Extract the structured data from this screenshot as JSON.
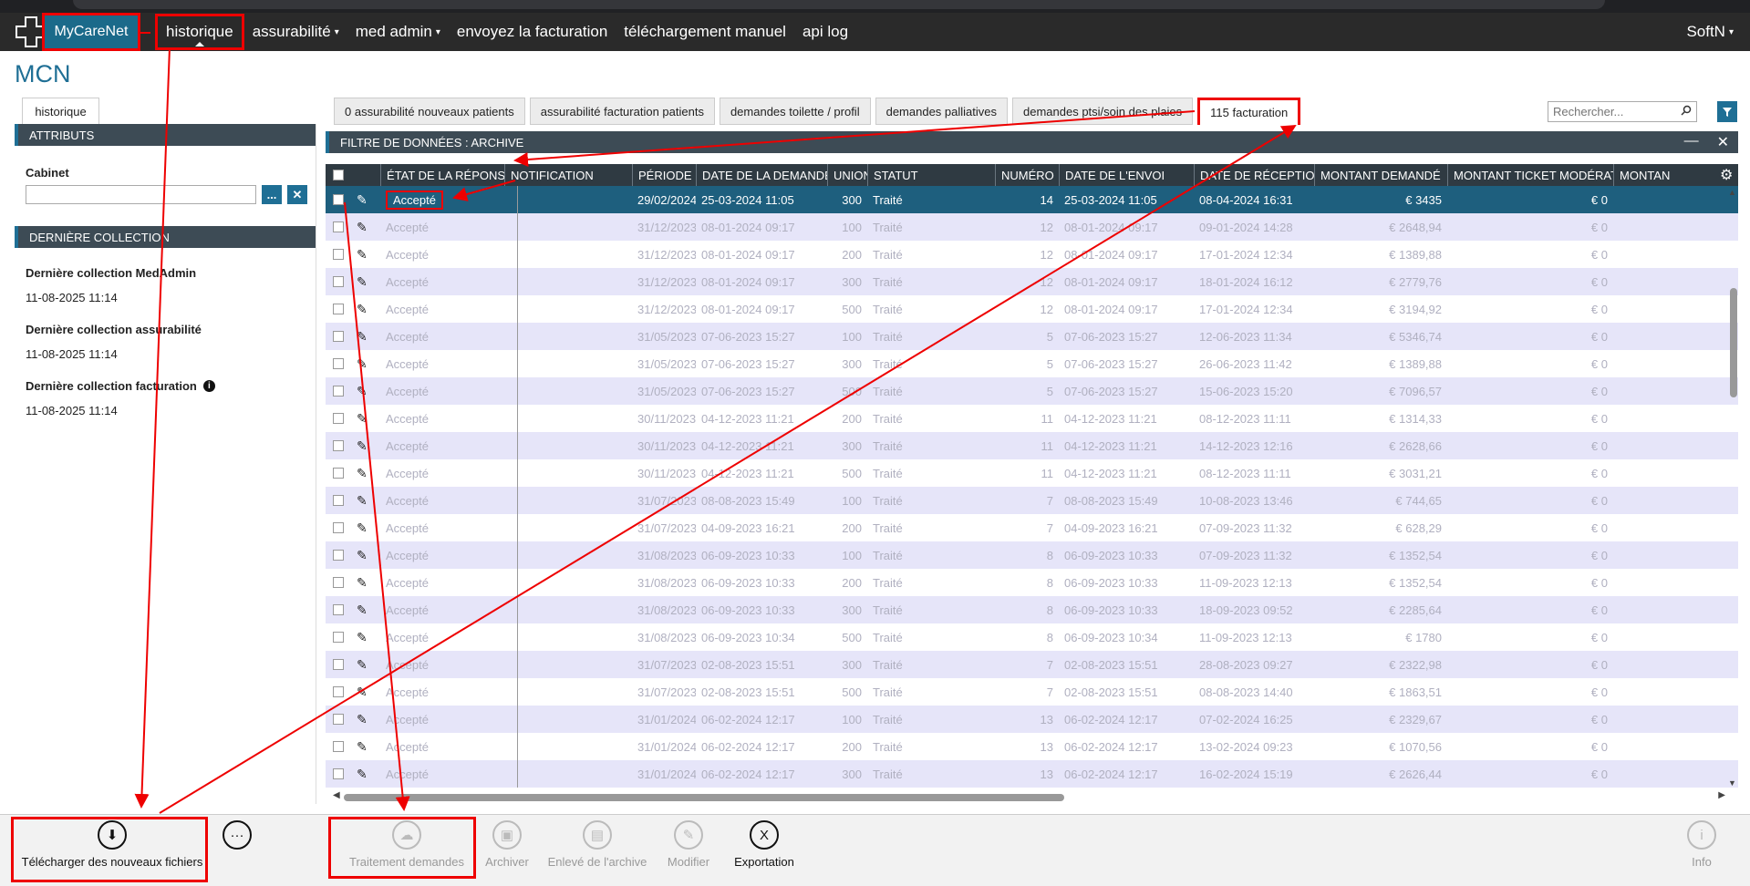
{
  "nav": {
    "brand": "MyCareNet",
    "items": [
      {
        "label": "historique",
        "dropdown": false,
        "active": true
      },
      {
        "label": "assurabilité",
        "dropdown": true,
        "active": false
      },
      {
        "label": "med admin",
        "dropdown": true,
        "active": false
      },
      {
        "label": "envoyez la facturation",
        "dropdown": false,
        "active": false
      },
      {
        "label": "téléchargement manuel",
        "dropdown": false,
        "active": false
      },
      {
        "label": "api log",
        "dropdown": false,
        "active": false
      }
    ],
    "user": "SoftN",
    "caret": "▾"
  },
  "app_title": "MCN",
  "left": {
    "tab": "historique",
    "attributes_header": "ATTRIBUTS",
    "cabinet_label": "Cabinet",
    "cabinet_value": "",
    "browse_label": "...",
    "clear_label": "✕",
    "collection_header": "DERNIÈRE COLLECTION",
    "collections": [
      {
        "title": "Dernière collection MedAdmin",
        "value": "11-08-2025 11:14",
        "info": false
      },
      {
        "title": "Dernière collection assurabilité",
        "value": "11-08-2025 11:14",
        "info": false
      },
      {
        "title": "Dernière collection facturation",
        "value": "11-08-2025 11:14",
        "info": true
      }
    ]
  },
  "tabs": [
    {
      "label": "0 assurabilité nouveaux patients",
      "active": false
    },
    {
      "label": "assurabilité facturation patients",
      "active": false
    },
    {
      "label": "demandes toilette / profil",
      "active": false
    },
    {
      "label": "demandes palliatives",
      "active": false
    },
    {
      "label": "demandes ptsi/soin des plaies",
      "active": false
    },
    {
      "label": "115 facturation",
      "active": true
    }
  ],
  "search": {
    "placeholder": "Rechercher..."
  },
  "filter_header": "FILTRE DE DONNÉES : ARCHIVE",
  "window_controls": {
    "minimize": "—",
    "close": "✕"
  },
  "columns": [
    "État de la réponse",
    "Notification",
    "Période",
    "Date de la demande",
    "Union",
    "Statut",
    "Numéro",
    "Date de l'envoi",
    "Date de réception",
    "Montant demandé",
    "Montant ticket modérateur",
    "Montan"
  ],
  "rows": [
    {
      "etat": "Accepté",
      "notification": "",
      "periode": "29/02/2024",
      "date_demande": "25-03-2024 11:05",
      "union": "300",
      "statut": "Traité",
      "numero": "14",
      "date_envoi": "25-03-2024 11:05",
      "date_reception": "08-04-2024 16:31",
      "montant": "€ 3435",
      "ticket": "€ 0",
      "selected": true
    },
    {
      "etat": "Accepté",
      "notification": "",
      "periode": "31/12/2023",
      "date_demande": "08-01-2024 09:17",
      "union": "100",
      "statut": "Traité",
      "numero": "12",
      "date_envoi": "08-01-2024 09:17",
      "date_reception": "09-01-2024 14:28",
      "montant": "€ 2648,94",
      "ticket": "€ 0",
      "selected": false
    },
    {
      "etat": "Accepté",
      "notification": "",
      "periode": "31/12/2023",
      "date_demande": "08-01-2024 09:17",
      "union": "200",
      "statut": "Traité",
      "numero": "12",
      "date_envoi": "08-01-2024 09:17",
      "date_reception": "17-01-2024 12:34",
      "montant": "€ 1389,88",
      "ticket": "€ 0",
      "selected": false
    },
    {
      "etat": "Accepté",
      "notification": "",
      "periode": "31/12/2023",
      "date_demande": "08-01-2024 09:17",
      "union": "300",
      "statut": "Traité",
      "numero": "12",
      "date_envoi": "08-01-2024 09:17",
      "date_reception": "18-01-2024 16:12",
      "montant": "€ 2779,76",
      "ticket": "€ 0",
      "selected": false
    },
    {
      "etat": "Accepté",
      "notification": "",
      "periode": "31/12/2023",
      "date_demande": "08-01-2024 09:17",
      "union": "500",
      "statut": "Traité",
      "numero": "12",
      "date_envoi": "08-01-2024 09:17",
      "date_reception": "17-01-2024 12:34",
      "montant": "€ 3194,92",
      "ticket": "€ 0",
      "selected": false
    },
    {
      "etat": "Accepté",
      "notification": "",
      "periode": "31/05/2023",
      "date_demande": "07-06-2023 15:27",
      "union": "100",
      "statut": "Traité",
      "numero": "5",
      "date_envoi": "07-06-2023 15:27",
      "date_reception": "12-06-2023 11:34",
      "montant": "€ 5346,74",
      "ticket": "€ 0",
      "selected": false
    },
    {
      "etat": "Accepté",
      "notification": "",
      "periode": "31/05/2023",
      "date_demande": "07-06-2023 15:27",
      "union": "300",
      "statut": "Traité",
      "numero": "5",
      "date_envoi": "07-06-2023 15:27",
      "date_reception": "26-06-2023 11:42",
      "montant": "€ 1389,88",
      "ticket": "€ 0",
      "selected": false
    },
    {
      "etat": "Accepté",
      "notification": "",
      "periode": "31/05/2023",
      "date_demande": "07-06-2023 15:27",
      "union": "500",
      "statut": "Traité",
      "numero": "5",
      "date_envoi": "07-06-2023 15:27",
      "date_reception": "15-06-2023 15:20",
      "montant": "€ 7096,57",
      "ticket": "€ 0",
      "selected": false
    },
    {
      "etat": "Accepté",
      "notification": "",
      "periode": "30/11/2023",
      "date_demande": "04-12-2023 11:21",
      "union": "200",
      "statut": "Traité",
      "numero": "11",
      "date_envoi": "04-12-2023 11:21",
      "date_reception": "08-12-2023 11:11",
      "montant": "€ 1314,33",
      "ticket": "€ 0",
      "selected": false
    },
    {
      "etat": "Accepté",
      "notification": "",
      "periode": "30/11/2023",
      "date_demande": "04-12-2023 11:21",
      "union": "300",
      "statut": "Traité",
      "numero": "11",
      "date_envoi": "04-12-2023 11:21",
      "date_reception": "14-12-2023 12:16",
      "montant": "€ 2628,66",
      "ticket": "€ 0",
      "selected": false
    },
    {
      "etat": "Accepté",
      "notification": "",
      "periode": "30/11/2023",
      "date_demande": "04-12-2023 11:21",
      "union": "500",
      "statut": "Traité",
      "numero": "11",
      "date_envoi": "04-12-2023 11:21",
      "date_reception": "08-12-2023 11:11",
      "montant": "€ 3031,21",
      "ticket": "€ 0",
      "selected": false
    },
    {
      "etat": "Accepté",
      "notification": "",
      "periode": "31/07/2023",
      "date_demande": "08-08-2023 15:49",
      "union": "100",
      "statut": "Traité",
      "numero": "7",
      "date_envoi": "08-08-2023 15:49",
      "date_reception": "10-08-2023 13:46",
      "montant": "€ 744,65",
      "ticket": "€ 0",
      "selected": false
    },
    {
      "etat": "Accepté",
      "notification": "",
      "periode": "31/07/2023",
      "date_demande": "04-09-2023 16:21",
      "union": "200",
      "statut": "Traité",
      "numero": "7",
      "date_envoi": "04-09-2023 16:21",
      "date_reception": "07-09-2023 11:32",
      "montant": "€ 628,29",
      "ticket": "€ 0",
      "selected": false
    },
    {
      "etat": "Accepté",
      "notification": "",
      "periode": "31/08/2023",
      "date_demande": "06-09-2023 10:33",
      "union": "100",
      "statut": "Traité",
      "numero": "8",
      "date_envoi": "06-09-2023 10:33",
      "date_reception": "07-09-2023 11:32",
      "montant": "€ 1352,54",
      "ticket": "€ 0",
      "selected": false
    },
    {
      "etat": "Accepté",
      "notification": "",
      "periode": "31/08/2023",
      "date_demande": "06-09-2023 10:33",
      "union": "200",
      "statut": "Traité",
      "numero": "8",
      "date_envoi": "06-09-2023 10:33",
      "date_reception": "11-09-2023 12:13",
      "montant": "€ 1352,54",
      "ticket": "€ 0",
      "selected": false
    },
    {
      "etat": "Accepté",
      "notification": "",
      "periode": "31/08/2023",
      "date_demande": "06-09-2023 10:33",
      "union": "300",
      "statut": "Traité",
      "numero": "8",
      "date_envoi": "06-09-2023 10:33",
      "date_reception": "18-09-2023 09:52",
      "montant": "€ 2285,64",
      "ticket": "€ 0",
      "selected": false
    },
    {
      "etat": "Accepté",
      "notification": "",
      "periode": "31/08/2023",
      "date_demande": "06-09-2023 10:34",
      "union": "500",
      "statut": "Traité",
      "numero": "8",
      "date_envoi": "06-09-2023 10:34",
      "date_reception": "11-09-2023 12:13",
      "montant": "€ 1780",
      "ticket": "€ 0",
      "selected": false
    },
    {
      "etat": "Accepté",
      "notification": "",
      "periode": "31/07/2023",
      "date_demande": "02-08-2023 15:51",
      "union": "300",
      "statut": "Traité",
      "numero": "7",
      "date_envoi": "02-08-2023 15:51",
      "date_reception": "28-08-2023 09:27",
      "montant": "€ 2322,98",
      "ticket": "€ 0",
      "selected": false
    },
    {
      "etat": "Accepté",
      "notification": "",
      "periode": "31/07/2023",
      "date_demande": "02-08-2023 15:51",
      "union": "500",
      "statut": "Traité",
      "numero": "7",
      "date_envoi": "02-08-2023 15:51",
      "date_reception": "08-08-2023 14:40",
      "montant": "€ 1863,51",
      "ticket": "€ 0",
      "selected": false
    },
    {
      "etat": "Accepté",
      "notification": "",
      "periode": "31/01/2024",
      "date_demande": "06-02-2024 12:17",
      "union": "100",
      "statut": "Traité",
      "numero": "13",
      "date_envoi": "06-02-2024 12:17",
      "date_reception": "07-02-2024 16:25",
      "montant": "€ 2329,67",
      "ticket": "€ 0",
      "selected": false
    },
    {
      "etat": "Accepté",
      "notification": "",
      "periode": "31/01/2024",
      "date_demande": "06-02-2024 12:17",
      "union": "200",
      "statut": "Traité",
      "numero": "13",
      "date_envoi": "06-02-2024 12:17",
      "date_reception": "13-02-2024 09:23",
      "montant": "€ 1070,56",
      "ticket": "€ 0",
      "selected": false
    },
    {
      "etat": "Accepté",
      "notification": "",
      "periode": "31/01/2024",
      "date_demande": "06-02-2024 12:17",
      "union": "300",
      "statut": "Traité",
      "numero": "13",
      "date_envoi": "06-02-2024 12:17",
      "date_reception": "16-02-2024 15:19",
      "montant": "€ 2626,44",
      "ticket": "€ 0",
      "selected": false
    }
  ],
  "toolbar": [
    {
      "label": "Télécharger des nouveaux fichiers",
      "icon": "download-icon",
      "glyph": "⬇",
      "enabled": true
    },
    {
      "label": "",
      "icon": "more-icon",
      "glyph": "···",
      "enabled": true
    },
    {
      "label": "Traitement demandes",
      "icon": "cloud-process-icon",
      "glyph": "☁",
      "enabled": false
    },
    {
      "label": "Archiver",
      "icon": "archive-icon",
      "glyph": "▣",
      "enabled": false
    },
    {
      "label": "Enlevé de l'archive",
      "icon": "unarchive-icon",
      "glyph": "▤",
      "enabled": false
    },
    {
      "label": "Modifier",
      "icon": "pencil-icon",
      "glyph": "✎",
      "enabled": false
    },
    {
      "label": "Exportation",
      "icon": "excel-icon",
      "glyph": "X",
      "enabled": true
    },
    {
      "label": "Info",
      "icon": "info-icon",
      "glyph": "i",
      "enabled": false
    }
  ],
  "colors": {
    "accent": "#1f6f95",
    "annotation": "#ee0000",
    "selected_row": "#1e5f7e",
    "odd_row": "#e6e5f9"
  }
}
